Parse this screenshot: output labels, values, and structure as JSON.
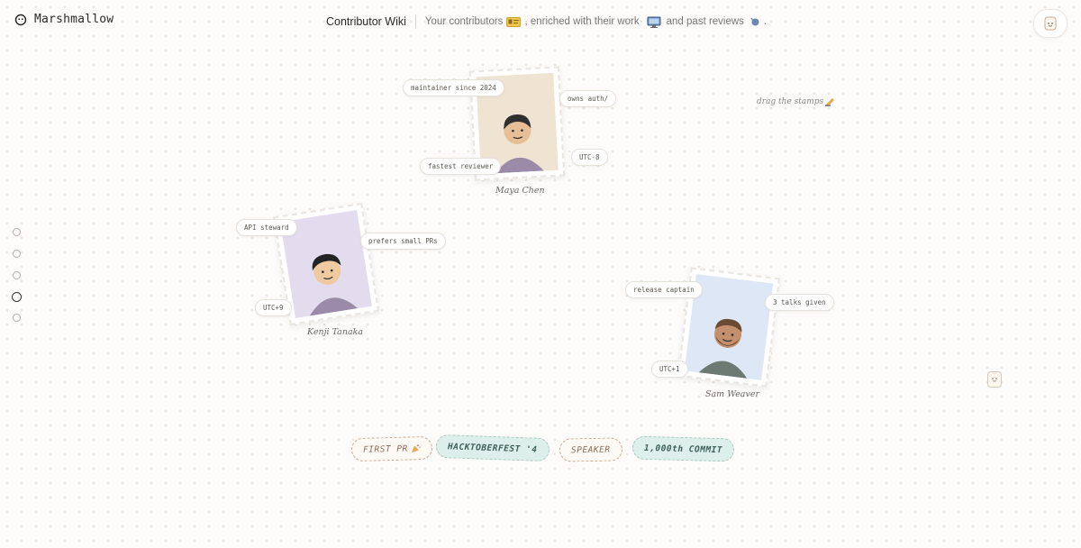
{
  "header": {
    "brand_name": "Marshmallow",
    "wiki_title": "Contributor Wiki",
    "tagline": {
      "part1": "Your contributors",
      "part2": ", enriched with their work",
      "part3": "and past reviews",
      "part4": "."
    }
  },
  "drag_hint": "drag the stamps",
  "side_nav": {
    "active_index": 3,
    "count": 5
  },
  "contributors": [
    {
      "name": "Maya Chen",
      "stamp_color": "#efe3d2",
      "shirt_color": "#9b8ba8",
      "skin_color": "#e7bf97",
      "hair_color": "#2f2f2f",
      "tags": [
        "maintainer since 2024",
        "owns auth/",
        "fastest reviewer",
        "UTC-8"
      ]
    },
    {
      "name": "Kenji Tanaka",
      "stamp_color": "#e3dcef",
      "shirt_color": "#9b8ba8",
      "skin_color": "#efc9a0",
      "hair_color": "#232323",
      "tags": [
        "API steward",
        "prefers small PRs",
        "UTC+9"
      ]
    },
    {
      "name": "Sam Weaver",
      "stamp_color": "#dde7f5",
      "shirt_color": "#6d7a73",
      "skin_color": "#c48f6c",
      "hair_color": "#6a4a32",
      "tags": [
        "release captain",
        "3 talks given",
        "UTC+1"
      ]
    }
  ],
  "badges": [
    {
      "label": "FIRST PR",
      "style": "outline"
    },
    {
      "label": "HACKTOBERFEST '4",
      "style": "filled"
    },
    {
      "label": "SPEAKER",
      "style": "outline"
    },
    {
      "label": "1,000th COMMIT",
      "style": "filled"
    }
  ],
  "icons": {
    "brand": "marshmallow-icon",
    "contributors_emoji": "id-card-icon",
    "work_emoji": "computer-icon",
    "reviews_emoji": "speech-bubble-icon",
    "hint_emoji": "writing-hand-icon",
    "first_pr_emoji": "party-icon"
  }
}
